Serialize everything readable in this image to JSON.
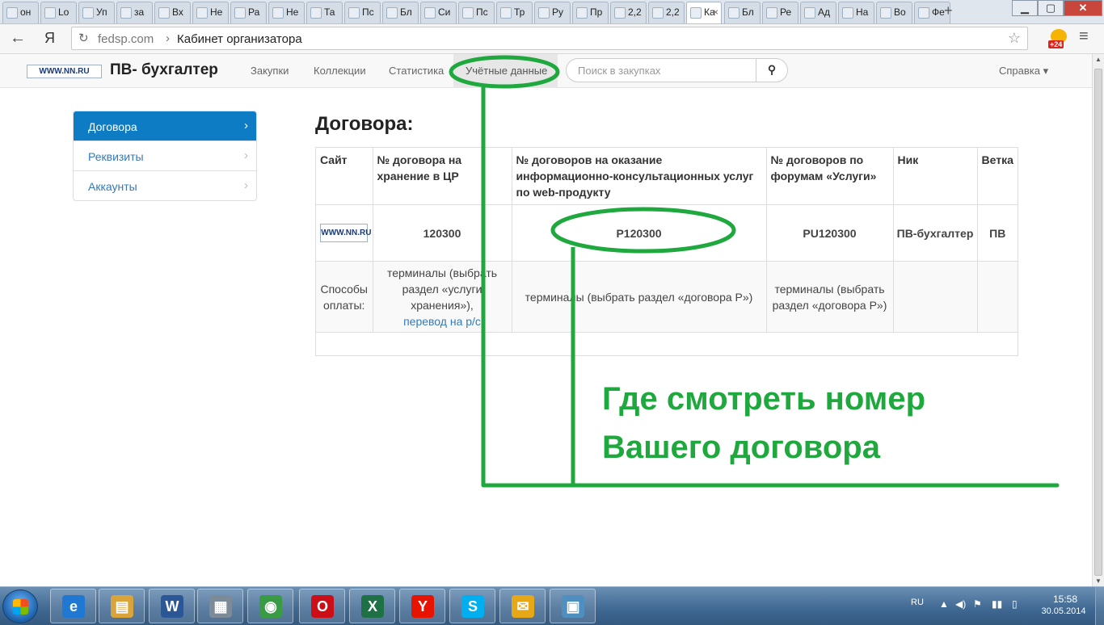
{
  "browser": {
    "tabs": [
      {
        "label": "он",
        "icon": "yandex-icon"
      },
      {
        "label": "Lo",
        "icon": "penguin-icon"
      },
      {
        "label": "Уп",
        "icon": "cart-icon"
      },
      {
        "label": "за",
        "icon": "spreadsheet-icon"
      },
      {
        "label": "Вх",
        "icon": "gmail-icon"
      },
      {
        "label": "Не",
        "icon": "spreadsheet-icon"
      },
      {
        "label": "Ра",
        "icon": "spreadsheet-icon"
      },
      {
        "label": "Не",
        "icon": "spreadsheet-icon"
      },
      {
        "label": "Та",
        "icon": "spreadsheet-icon"
      },
      {
        "label": "Пс",
        "icon": "page-icon"
      },
      {
        "label": "Бл",
        "icon": "page-icon"
      },
      {
        "label": "Си",
        "icon": "page-icon"
      },
      {
        "label": "Пс",
        "icon": "page-icon"
      },
      {
        "label": "Тр",
        "icon": "page-icon"
      },
      {
        "label": "Ру",
        "icon": "page-icon"
      },
      {
        "label": "Пр",
        "icon": "page-icon"
      },
      {
        "label": "2,2",
        "icon": "page-icon"
      },
      {
        "label": "2,2",
        "icon": "page-icon"
      },
      {
        "label": "Ка",
        "icon": "page-icon",
        "active": true
      },
      {
        "label": "Бл",
        "icon": "page-icon"
      },
      {
        "label": "Ре",
        "icon": "page-icon"
      },
      {
        "label": "Ад",
        "icon": "page-icon"
      },
      {
        "label": "На",
        "icon": "vk-icon"
      },
      {
        "label": "Во",
        "icon": "page-icon"
      },
      {
        "label": "Фе",
        "icon": "page-icon"
      }
    ],
    "new_tab": "+",
    "close_tab": "×",
    "yandex_button": "Я",
    "url_domain": "fedsp.com",
    "url_separator": "›",
    "url_title": "Кабинет организатора",
    "weather_badge": "+24"
  },
  "site": {
    "logo_text": "WWW.NN.RU",
    "brand": "ПВ- бухгалтер",
    "nav": [
      "Закупки",
      "Коллекции",
      "Статистика",
      "Учётные данные"
    ],
    "search_placeholder": "Поиск в закупках",
    "help": "Справка ▾"
  },
  "sidebar": {
    "items": [
      {
        "label": "Договора",
        "active": true
      },
      {
        "label": "Реквизиты"
      },
      {
        "label": "Аккаунты"
      }
    ]
  },
  "main": {
    "title": "Договора:",
    "columns": [
      "Сайт",
      "№ договора на хранение в ЦР",
      "№ договоров на оказание информационно-консультационных услуг по web-продукту",
      "№ договоров по форумам «Услуги»",
      "Ник",
      "Ветка"
    ],
    "row": {
      "storage_no": "120300",
      "service_no": "P120300",
      "forum_no": "PU120300",
      "nick": "ПВ-бухгалтер",
      "branch": "ПВ"
    },
    "payment": {
      "label": "Способы оплаты:",
      "storage_text": "терминалы (выбрать раздел «услуги хранения»),",
      "storage_link": "перевод на р/с",
      "service_text": "терминалы (выбрать раздел «договора P»)",
      "forum_text": "терминалы (выбрать раздел «договора P»)"
    }
  },
  "annotation": {
    "line1": "Где смотреть номер",
    "line2": "Вашего договора",
    "color": "#1fa83e"
  },
  "taskbar": {
    "apps": [
      {
        "name": "ie-icon",
        "glyph": "e",
        "color": "#1f78d1"
      },
      {
        "name": "explorer-icon",
        "glyph": "▤",
        "color": "#d9a53a"
      },
      {
        "name": "word-icon",
        "glyph": "W",
        "color": "#2b5797"
      },
      {
        "name": "calculator-icon",
        "glyph": "▦",
        "color": "#7d8b99"
      },
      {
        "name": "chrome-icon",
        "glyph": "◉",
        "color": "#3a9b45"
      },
      {
        "name": "opera-icon",
        "glyph": "O",
        "color": "#cc0f16"
      },
      {
        "name": "excel-icon",
        "glyph": "X",
        "color": "#1e7145"
      },
      {
        "name": "yandex-browser-icon",
        "glyph": "Y",
        "color": "#e61400"
      },
      {
        "name": "skype-icon",
        "glyph": "S",
        "color": "#00aff0"
      },
      {
        "name": "mail-agent-icon",
        "glyph": "✉",
        "color": "#e6a817"
      },
      {
        "name": "picture-viewer-icon",
        "glyph": "▣",
        "color": "#4f8fc0"
      }
    ],
    "lang": "RU",
    "time": "15:58",
    "date": "30.05.2014"
  }
}
